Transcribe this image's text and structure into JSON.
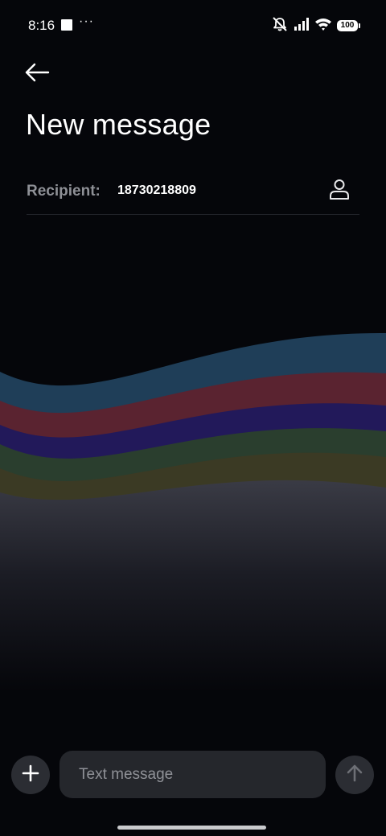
{
  "status_bar": {
    "time": "8:16",
    "more": "···",
    "battery": "100",
    "icons": [
      "square-notification-icon",
      "mute-icon",
      "signal-icon",
      "wifi-icon",
      "battery-icon"
    ]
  },
  "header": {
    "title": "New message",
    "back_icon": "arrow-left-icon"
  },
  "recipient": {
    "label": "Recipient:",
    "value": "18730218809",
    "contact_icon": "person-icon"
  },
  "composer": {
    "placeholder": "Text message",
    "value": "",
    "add_icon": "plus-icon",
    "send_icon": "arrow-up-icon"
  },
  "colors": {
    "background": "#05060a",
    "wave_blue": "#1f3e58",
    "wave_red": "#5a2330",
    "wave_purple": "#22195a",
    "wave_green": "#2a3e2e",
    "wave_olive": "#3b3a24",
    "fog": "#3c3d47"
  }
}
